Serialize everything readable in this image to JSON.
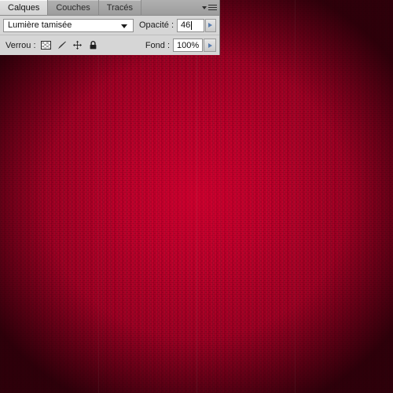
{
  "app": {
    "panel_title": "Calques"
  },
  "background": {
    "description": "red textured fabric image canvas",
    "center_color": "#cc0033",
    "edge_color": "#2e0007"
  },
  "panel": {
    "tabs": [
      {
        "label": "Calques",
        "active": true
      },
      {
        "label": "Couches",
        "active": false
      },
      {
        "label": "Tracés",
        "active": false
      }
    ],
    "menu_icon": "panel-menu-icon",
    "blend_mode": {
      "value": "Lumière tamisée",
      "arrow_icon": "chevron-down-icon"
    },
    "opacity": {
      "label": "Opacité :",
      "value": "46",
      "has_caret": true,
      "stepper_icon": "triangle-right-icon"
    },
    "lock": {
      "label": "Verrou :",
      "icons": [
        {
          "name": "lock-transparency-icon",
          "title": "Verrouiller les pixels transparents"
        },
        {
          "name": "lock-image-brush-icon",
          "title": "Verrouiller les pixels de l'image"
        },
        {
          "name": "lock-position-move-icon",
          "title": "Verrouiller la position"
        },
        {
          "name": "lock-all-padlock-icon",
          "title": "Tout verrouiller"
        }
      ]
    },
    "fill": {
      "label": "Fond :",
      "value": "100%",
      "stepper_icon": "triangle-right-icon"
    }
  }
}
